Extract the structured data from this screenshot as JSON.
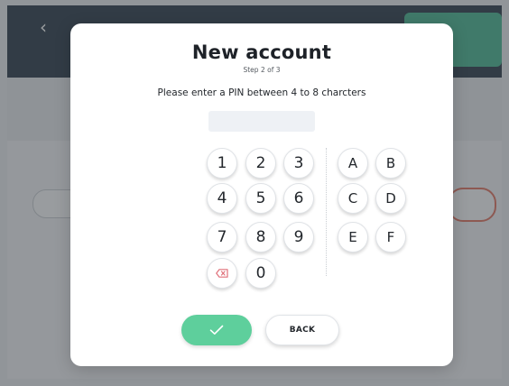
{
  "background": {
    "header_back_icon": "chevron-left-icon",
    "accent_green": "#3ab38a",
    "header_color": "#1b2b3a",
    "pill_border_red": "#e46a55"
  },
  "modal": {
    "title": "New account",
    "step": "Step 2 of 3",
    "instructions": "Please enter a PIN between 4 to 8 charcters",
    "pin_value": "",
    "keypad": {
      "digits": [
        "1",
        "2",
        "3",
        "4",
        "5",
        "6",
        "7",
        "8",
        "9",
        "0"
      ],
      "letters": [
        "A",
        "B",
        "C",
        "D",
        "E",
        "F"
      ],
      "backspace_icon": "backspace-icon"
    },
    "confirm_icon": "check-icon",
    "confirm_color": "#5ecf9c",
    "back_label": "BACK"
  }
}
